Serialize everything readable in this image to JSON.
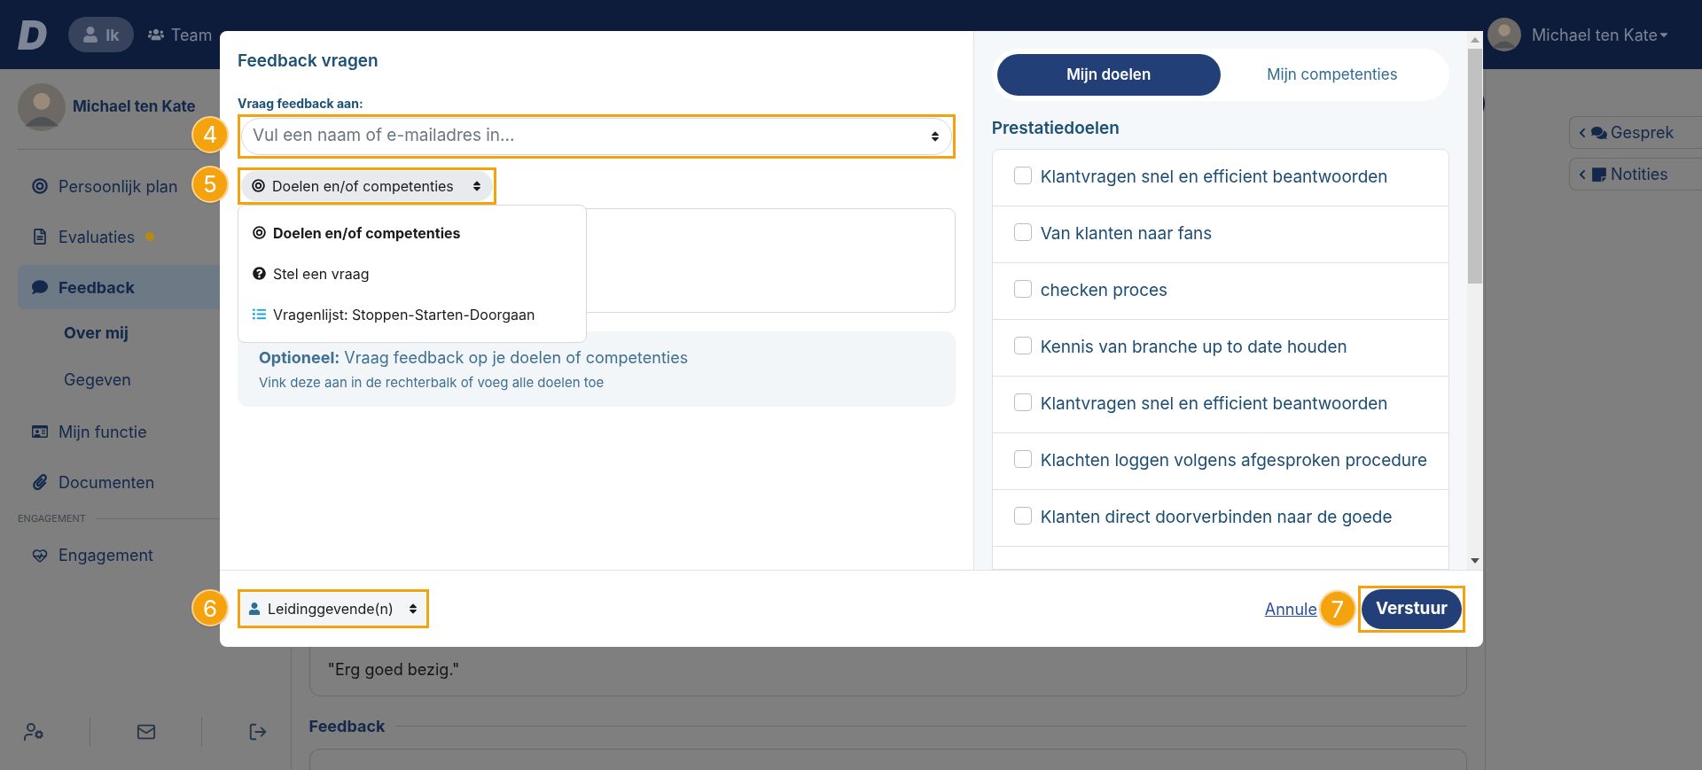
{
  "header": {
    "logo": "D",
    "nav": [
      {
        "label": "Ik",
        "selected": true
      },
      {
        "label": "Team",
        "selected": false
      }
    ],
    "user": "Michael ten Kate"
  },
  "sidebar": {
    "user": "Michael ten Kate",
    "items": [
      {
        "label": "Persoonlijk plan",
        "selected": false,
        "dot": false
      },
      {
        "label": "Evaluaties",
        "selected": false,
        "dot": true
      },
      {
        "label": "Feedback",
        "selected": true,
        "dot": false,
        "children": [
          {
            "label": "Over mij",
            "selected": true
          },
          {
            "label": "Gegeven",
            "selected": false
          }
        ]
      },
      {
        "label": "Mijn functie",
        "selected": false,
        "dot": false
      },
      {
        "label": "Documenten",
        "selected": false,
        "dot": false
      }
    ],
    "section": "ENGAGEMENT",
    "section_items": [
      {
        "label": "Engagement",
        "selected": false,
        "dot": false
      }
    ]
  },
  "main": {
    "quote": "\"Erg goed bezig.\"",
    "heading": "Feedback"
  },
  "side_buttons": [
    {
      "label": "Gesprek"
    },
    {
      "label": "Notities"
    }
  ],
  "modal": {
    "title": "Feedback vragen",
    "to_label": "Vraag feedback aan:",
    "to_placeholder": "Vul een naam of e-mailadres in...",
    "type_select": {
      "label": "Doelen en/of competenties",
      "badge": "5"
    },
    "type_options": [
      {
        "label": "Doelen en/of competenties",
        "selected": true
      },
      {
        "label": "Stel een vraag",
        "selected": false
      },
      {
        "label": "Vragenlijst: Stoppen-Starten-Doorgaan",
        "selected": false
      }
    ],
    "to_badge": "4",
    "info": {
      "title": "**Optioneel:** Vraag feedback op je doelen of competenties",
      "text": "Vink deze aan in de rechterbalk of voeg alle doelen toe"
    },
    "audience": {
      "label": "Leidinggevende(n)",
      "badge": "6"
    },
    "cancel": "Annule",
    "submit": {
      "label": "Verstuur",
      "badge": "7"
    },
    "tabs": [
      {
        "label": "Mijn doelen",
        "selected": true
      },
      {
        "label": "Mijn competenties",
        "selected": false
      }
    ],
    "section": "Prestatiedoelen",
    "goals": [
      {
        "label": "Klantvragen snel en efficient beantwoorden",
        "checked": false
      },
      {
        "label": "Van klanten naar fans",
        "checked": false
      },
      {
        "label": "checken proces",
        "checked": false
      },
      {
        "label": "Kennis van branche up to date houden",
        "checked": false
      },
      {
        "label": "Klantvragen snel en efficient beantwoorden",
        "checked": false
      },
      {
        "label": "Klachten loggen volgens afgesproken procedure",
        "checked": false
      },
      {
        "label": "Klanten direct doorverbinden naar de goede",
        "checked": false
      }
    ]
  }
}
